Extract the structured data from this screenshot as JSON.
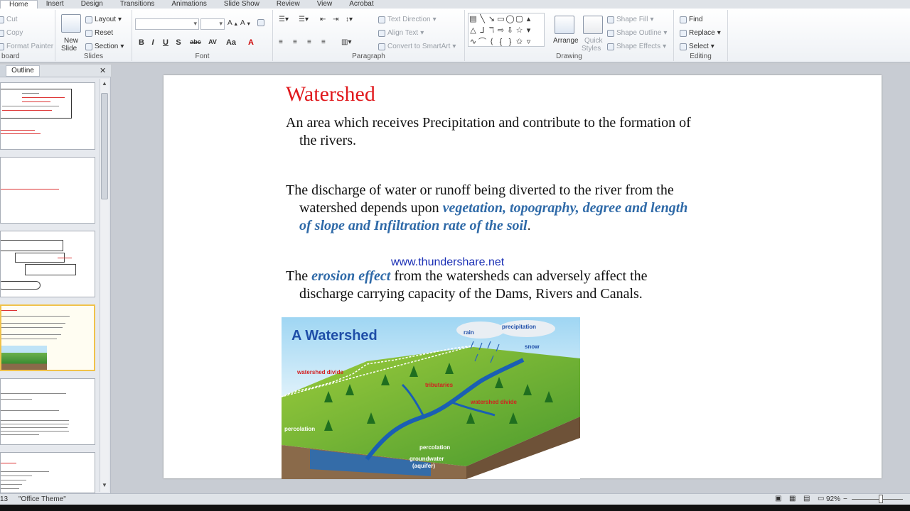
{
  "ribbon_tabs": [
    "Home",
    "Insert",
    "Design",
    "Transitions",
    "Animations",
    "Slide Show",
    "Review",
    "View",
    "Acrobat"
  ],
  "clipboard": {
    "cut": "Cut",
    "copy": "Copy",
    "format_painter": "Format Painter",
    "label": "board"
  },
  "slides": {
    "new_slide": "New",
    "new_slide2": "Slide",
    "layout": "Layout",
    "reset": "Reset",
    "section": "Section",
    "label": "Slides"
  },
  "font": {
    "label": "Font",
    "buttons": [
      "B",
      "I",
      "U",
      "S",
      "abc",
      "AV",
      "Aa",
      "A"
    ]
  },
  "paragraph": {
    "text_direction": "Text Direction",
    "align_text": "Align Text",
    "convert_smartart": "Convert to SmartArt",
    "label": "Paragraph"
  },
  "drawing": {
    "arrange": "Arrange",
    "quick_styles": "Quick",
    "quick_styles2": "Styles",
    "shape_fill": "Shape Fill",
    "shape_outline": "Shape Outline",
    "shape_effects": "Shape Effects",
    "label": "Drawing"
  },
  "editing": {
    "find": "Find",
    "replace": "Replace",
    "select": "Select",
    "label": "Editing"
  },
  "left_panel": {
    "outline_tab": "Outline",
    "close": "✕"
  },
  "slide": {
    "title": "Watershed",
    "p1": "An area which receives Precipitation and contribute to the formation of",
    "p1b": "the rivers.",
    "p2a": "The discharge of water or runoff being diverted to the river from the",
    "p2b": "watershed depends upon ",
    "p2_hi1": "vegetation, topography, degree and length",
    "p2_hi2": "of slope and Infiltration rate of the soil",
    "p2_end": ".",
    "watermark": "www.thundershare.net",
    "p3a": "The ",
    "p3_hi": "erosion effect",
    "p3b": " from the watersheds can adversely affect the",
    "p3c": "discharge carrying capacity of the Dams, Rivers and Canals.",
    "picture": {
      "heading": "A Watershed",
      "labels": {
        "rain": "rain",
        "precipitation": "precipitation",
        "snow": "snow",
        "watershed_divide_1": "watershed divide",
        "tributaries": "tributaries",
        "watershed_divide_2": "watershed divide",
        "percolation_1": "percolation",
        "percolation_2": "percolation",
        "groundwater": "groundwater",
        "aquifer": "(aquifer)"
      }
    }
  },
  "status": {
    "slide_num": "13",
    "theme": "\"Office Theme\"",
    "zoom": "92%"
  },
  "colors": {
    "title_red": "#e0181c",
    "highlight_blue": "#2f6aa8",
    "watermark_blue": "#1a2fb5"
  }
}
